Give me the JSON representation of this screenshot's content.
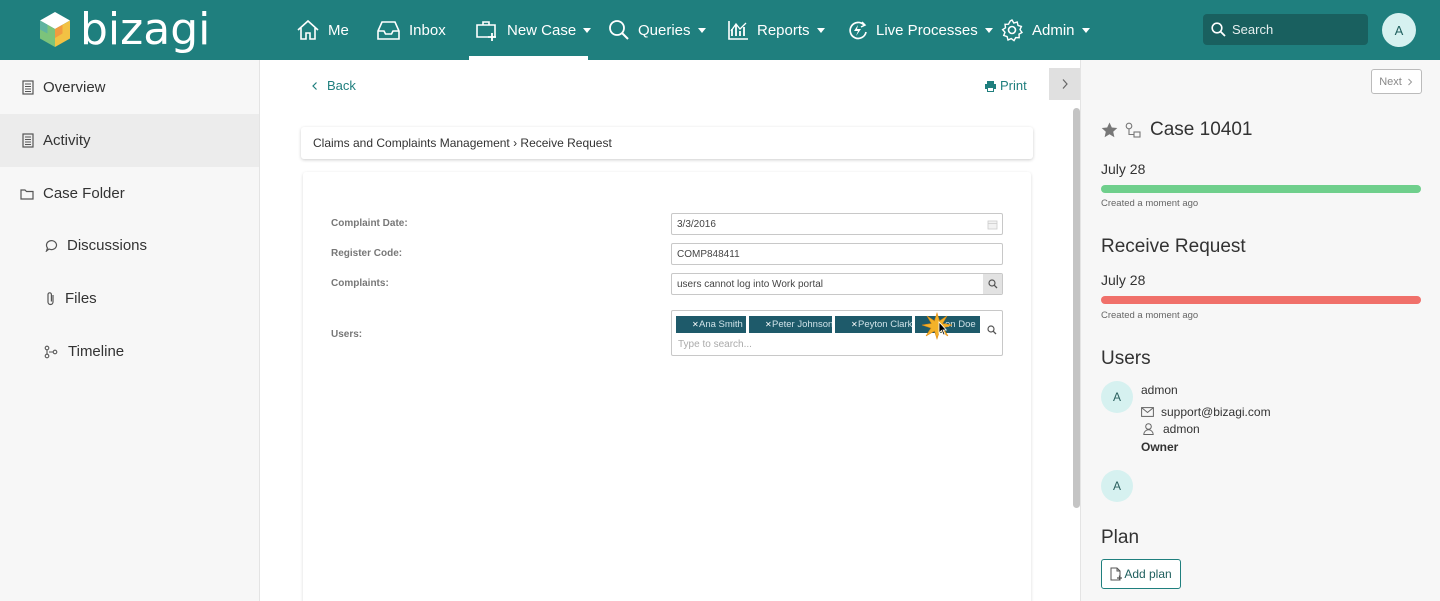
{
  "brand": {
    "name": "bizagi"
  },
  "nav": {
    "me": "Me",
    "inbox": "Inbox",
    "new_case": "New Case",
    "queries": "Queries",
    "reports": "Reports",
    "live_processes": "Live Processes",
    "admin": "Admin"
  },
  "search": {
    "placeholder": "Search"
  },
  "user": {
    "initial": "A"
  },
  "sidebar": {
    "items": [
      {
        "label": "Overview"
      },
      {
        "label": "Activity"
      },
      {
        "label": "Case Folder"
      },
      {
        "label": "Discussions"
      },
      {
        "label": "Files"
      },
      {
        "label": "Timeline"
      }
    ]
  },
  "main": {
    "back": "Back",
    "print": "Print",
    "breadcrumb": "Claims and Complaints Management › Receive Request",
    "form": {
      "complaint_date_label": "Complaint Date:",
      "complaint_date_value": "3/3/2016",
      "register_code_label": "Register Code:",
      "register_code_value": "COMP848411",
      "complaints_label": "Complaints:",
      "complaints_value": "users cannot log into Work portal",
      "users_label": "Users:",
      "users_chips": [
        "Ana Smith",
        "Peter Johnson",
        "Peyton Clark",
        "on Doe"
      ],
      "users_placeholder": "Type to search..."
    }
  },
  "right_panel": {
    "next": "Next",
    "case_title": "Case 10401",
    "case_date": "July 28",
    "case_progress": 1.0,
    "case_meta": "Created a moment ago",
    "activity_heading": "Receive Request",
    "activity_date": "July 28",
    "activity_progress": 1.0,
    "activity_meta": "Created a moment ago",
    "users_heading": "Users",
    "user1": {
      "initial": "A",
      "name": "admon",
      "email": "support@bizagi.com",
      "login": "admon",
      "role": "Owner"
    },
    "user2": {
      "initial": "A"
    },
    "plan_heading": "Plan",
    "add_plan": "Add plan"
  },
  "colors": {
    "topbar": "#1f7f7e",
    "chip": "#1e5a6a",
    "progress_green": "#6fcf8c",
    "progress_red": "#f0706a"
  }
}
